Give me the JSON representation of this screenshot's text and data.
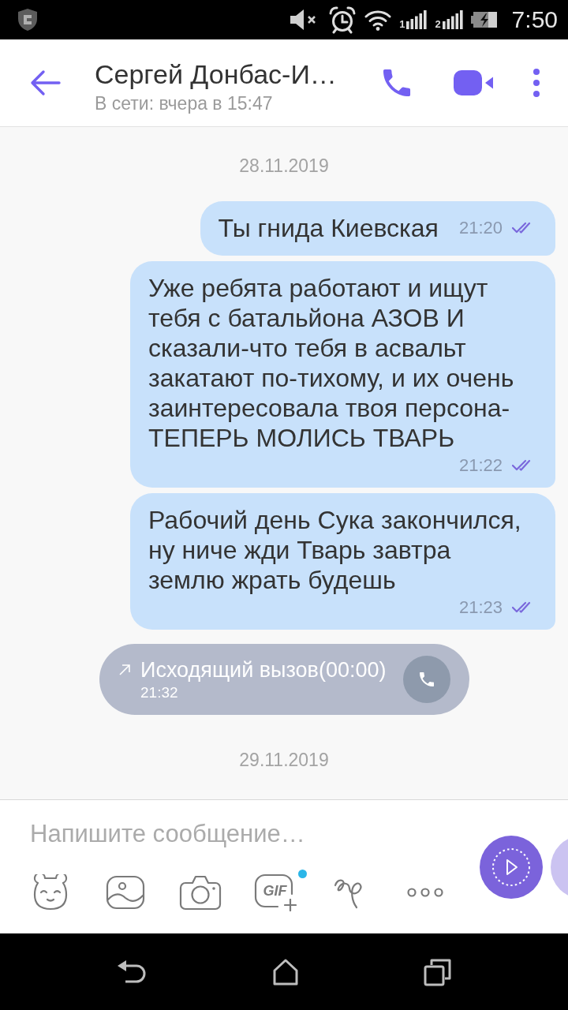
{
  "status_bar": {
    "sims": [
      {
        "label": "1"
      },
      {
        "label": "2"
      }
    ],
    "time": "7:50"
  },
  "header": {
    "title": "Сергей Донбас-И…",
    "subtitle": "В сети: вчера в 15:47"
  },
  "messages": [
    {
      "kind": "date",
      "text": "28.11.2019"
    },
    {
      "kind": "outgoing",
      "text": "Ты гнида Киевская",
      "time": "21:20",
      "seen": true
    },
    {
      "kind": "outgoing",
      "text": "Уже ребята работают и ищут тебя с батальйона АЗОВ И сказали-что тебя в асвальт закатают по-тихому, и их очень заинтересовала твоя персона-ТЕПЕРЬ МОЛИСЬ ТВАРЬ",
      "time": "21:22",
      "seen": true
    },
    {
      "kind": "outgoing",
      "text": "Рабочий день Сука закончился, ну ниче жди Тварь завтра землю жрать будешь",
      "time": "21:23",
      "seen": true
    },
    {
      "kind": "call",
      "text": "Исходящий вызов(00:00)",
      "time": "21:32"
    },
    {
      "kind": "date",
      "text": "29.11.2019"
    }
  ],
  "composer": {
    "placeholder": "Напишите сообщение…",
    "gif_label": "GIF",
    "gif_badge": true
  }
}
